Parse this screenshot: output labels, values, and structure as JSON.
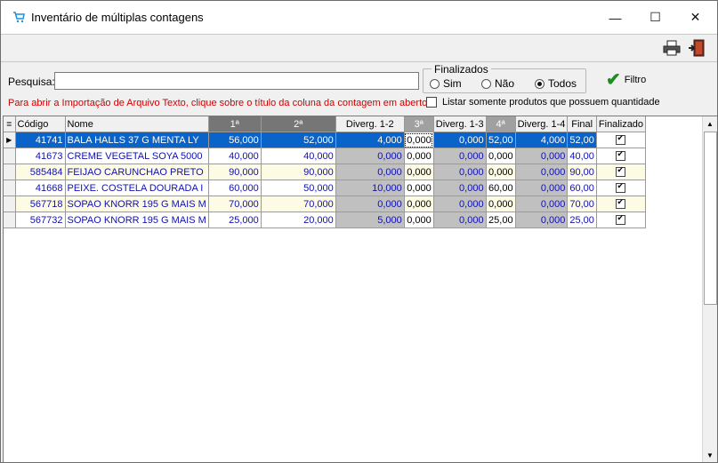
{
  "window": {
    "title": "Inventário de múltiplas contagens",
    "controls": {
      "minimize": "—",
      "maximize": "☐",
      "close": "✕"
    }
  },
  "toolbar": {
    "print_icon": "printer-icon",
    "exit_icon": "exit-door-icon"
  },
  "search": {
    "label": "Pesquisa:",
    "value": "",
    "placeholder": ""
  },
  "finalizados": {
    "legend": "Finalizados",
    "options": [
      "Sim",
      "Não",
      "Todos"
    ],
    "selected": "Todos"
  },
  "filter_button": {
    "label": "Filtro"
  },
  "hint_text": "Para abrir a Importação de Arquivo Texto, clique sobre o título da coluna da contagem em aberto.",
  "only_with_quantity": {
    "label": "Listar somente produtos que possuem quantidade",
    "checked": false
  },
  "grid": {
    "columns": [
      "Código",
      "Nome",
      "1ª",
      "2ª",
      "Diverg. 1-2",
      "3ª",
      "Diverg. 1-3",
      "4ª",
      "Diverg. 1-4",
      "Final",
      "Finalizado"
    ],
    "rows": [
      [
        "41741",
        "BALA HALLS 37 G MENTA LY",
        "56,000",
        "52,000",
        "4,000",
        "0,000",
        "0,000",
        "52,00",
        "4,000",
        "52,00",
        true
      ],
      [
        "41673",
        "CREME VEGETAL SOYA 5000",
        "40,000",
        "40,000",
        "0,000",
        "0,000",
        "0,000",
        "0,000",
        "0,000",
        "40,00",
        true
      ],
      [
        "585484",
        "FEIJAO CARUNCHAO PRETO",
        "90,000",
        "90,000",
        "0,000",
        "0,000",
        "0,000",
        "0,000",
        "0,000",
        "90,00",
        true
      ],
      [
        "41668",
        "PEIXE. COSTELA DOURADA I",
        "60,000",
        "50,000",
        "10,000",
        "0,000",
        "0,000",
        "60,00",
        "0,000",
        "60,00",
        true
      ],
      [
        "567718",
        "SOPAO KNORR 195 G MAIS M",
        "70,000",
        "70,000",
        "0,000",
        "0,000",
        "0,000",
        "0,000",
        "0,000",
        "70,00",
        true
      ],
      [
        "567732",
        "SOPAO KNORR 195 G MAIS M",
        "25,000",
        "20,000",
        "5,000",
        "0,000",
        "0,000",
        "25,00",
        "0,000",
        "25,00",
        true
      ]
    ]
  },
  "colors": {
    "selection": "#0a63c8",
    "value_text": "#1010b0",
    "hint": "#d00000",
    "diverg_bg": "#c0c0c0"
  }
}
